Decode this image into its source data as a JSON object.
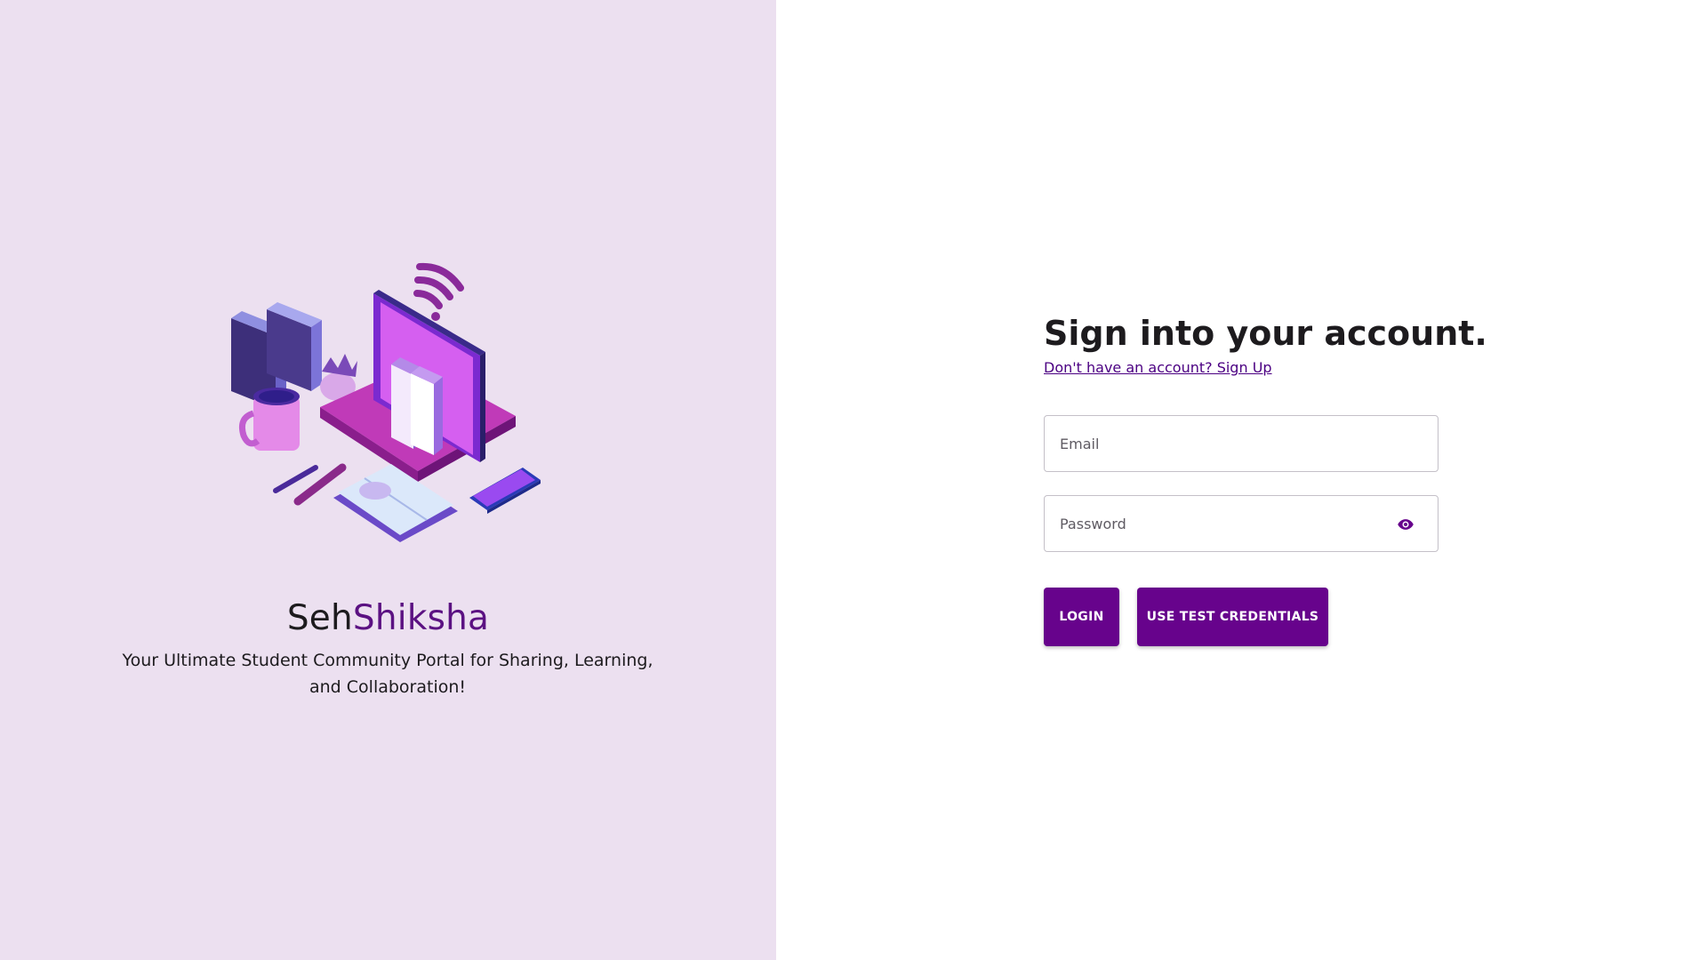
{
  "branding": {
    "name_part1": "Seh",
    "name_part2": "Shiksha",
    "tagline": "Your Ultimate Student Community Portal for Sharing, Learning, and Collaboration!",
    "illustration": "study-illustration"
  },
  "form": {
    "heading": "Sign into your account.",
    "signup_link": "Don't have an account? Sign Up",
    "email_placeholder": "Email",
    "password_placeholder": "Password",
    "password_toggle_icon": "eye-icon",
    "login_label": "LOGIN",
    "test_credentials_label": "USE TEST CREDENTIALS"
  },
  "colors": {
    "left_panel_bg": "#ece0f0",
    "accent": "#67038c",
    "brand_accent": "#5b1182",
    "link": "#4b0082"
  }
}
